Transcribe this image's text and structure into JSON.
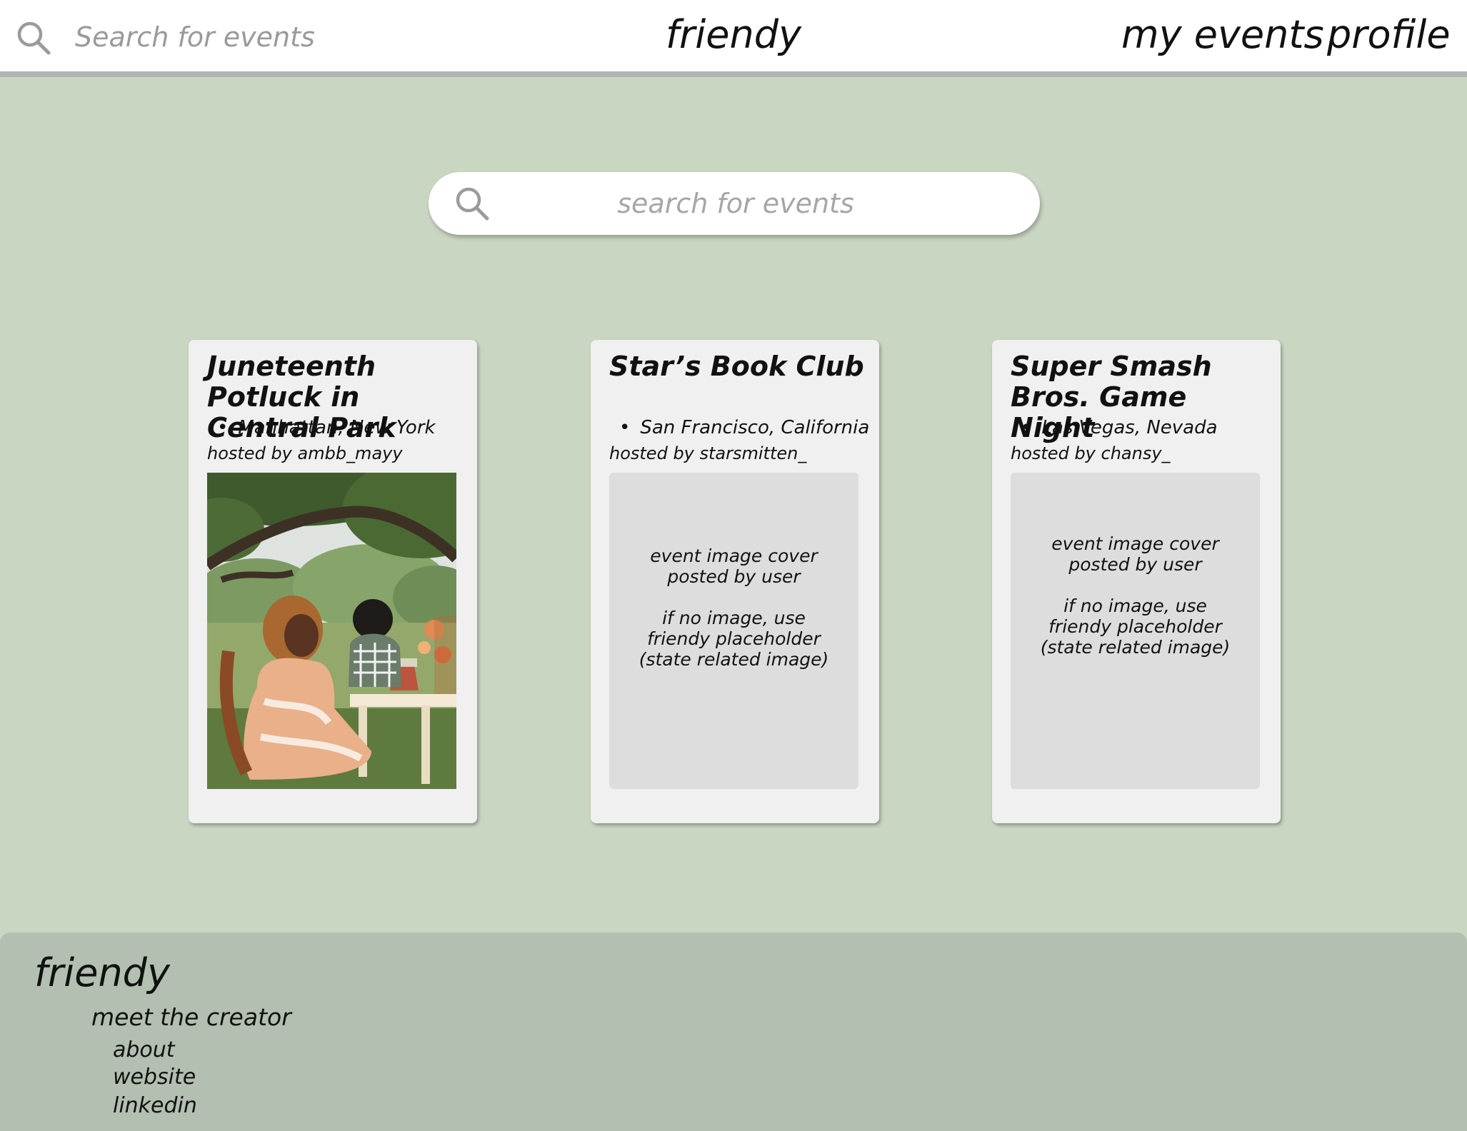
{
  "header": {
    "search_placeholder": "Search for events",
    "brand": "friendy",
    "nav": {
      "my_events": "my events",
      "profile": "profile"
    }
  },
  "hero": {
    "search_placeholder": "search for events"
  },
  "events": [
    {
      "title": "Juneteenth Potluck in Central Park",
      "location": "Manhattan, New York",
      "host": "hosted by ambb_mayy",
      "cover": "photo of people picnicking under trees in a park"
    },
    {
      "title": "Star’s Book Club",
      "location": "San Francisco, California",
      "host": "hosted by starsmitten_",
      "cover_placeholder": "event image cover\nposted by user\n\nif no image, use\nfriendy placeholder\n(state related image)"
    },
    {
      "title": "Super Smash Bros. Game Night",
      "location": "Las Vegas, Nevada",
      "host": "hosted by chansy_",
      "cover_placeholder": "event image cover\nposted by user\n\nif no image, use\nfriendy placeholder\n(state related image)"
    }
  ],
  "footer": {
    "brand": "friendy",
    "heading": "meet the creator",
    "links": [
      "about",
      "website",
      "linkedin"
    ]
  },
  "colors": {
    "page_background": "#c9d6c2",
    "footer_background": "#b3bfb0",
    "card_background": "#f0f0f0",
    "placeholder_background": "#dddddd",
    "topbar_border": "#b3b3b3"
  }
}
